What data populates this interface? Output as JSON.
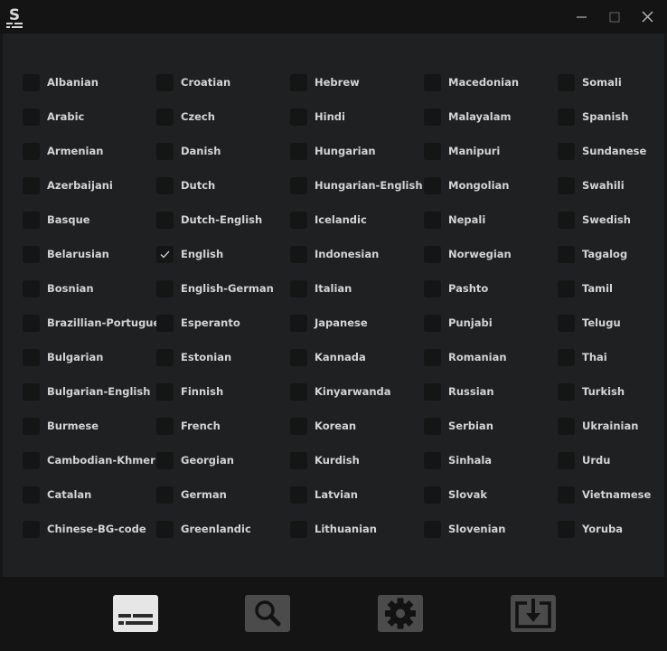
{
  "app": {
    "logo_letter": "S"
  },
  "window_controls": {
    "minimize_icon": "minimize-icon",
    "maximize_icon": "maximize-icon",
    "close_icon": "close-icon"
  },
  "languages": [
    {
      "label": "Albanian",
      "checked": false
    },
    {
      "label": "Arabic",
      "checked": false
    },
    {
      "label": "Armenian",
      "checked": false
    },
    {
      "label": "Azerbaijani",
      "checked": false
    },
    {
      "label": "Basque",
      "checked": false
    },
    {
      "label": "Belarusian",
      "checked": false
    },
    {
      "label": "Bosnian",
      "checked": false
    },
    {
      "label": "Brazillian-Portuguese",
      "checked": false
    },
    {
      "label": "Bulgarian",
      "checked": false
    },
    {
      "label": "Bulgarian-English",
      "checked": false
    },
    {
      "label": "Burmese",
      "checked": false
    },
    {
      "label": "Cambodian-Khmer",
      "checked": false
    },
    {
      "label": "Catalan",
      "checked": false
    },
    {
      "label": "Chinese-BG-code",
      "checked": false
    },
    {
      "label": "Croatian",
      "checked": false
    },
    {
      "label": "Czech",
      "checked": false
    },
    {
      "label": "Danish",
      "checked": false
    },
    {
      "label": "Dutch",
      "checked": false
    },
    {
      "label": "Dutch-English",
      "checked": false
    },
    {
      "label": "English",
      "checked": true
    },
    {
      "label": "English-German",
      "checked": false
    },
    {
      "label": "Esperanto",
      "checked": false
    },
    {
      "label": "Estonian",
      "checked": false
    },
    {
      "label": "Finnish",
      "checked": false
    },
    {
      "label": "French",
      "checked": false
    },
    {
      "label": "Georgian",
      "checked": false
    },
    {
      "label": "German",
      "checked": false
    },
    {
      "label": "Greenlandic",
      "checked": false
    },
    {
      "label": "Hebrew",
      "checked": false
    },
    {
      "label": "Hindi",
      "checked": false
    },
    {
      "label": "Hungarian",
      "checked": false
    },
    {
      "label": "Hungarian-English",
      "checked": false
    },
    {
      "label": "Icelandic",
      "checked": false
    },
    {
      "label": "Indonesian",
      "checked": false
    },
    {
      "label": "Italian",
      "checked": false
    },
    {
      "label": "Japanese",
      "checked": false
    },
    {
      "label": "Kannada",
      "checked": false
    },
    {
      "label": "Kinyarwanda",
      "checked": false
    },
    {
      "label": "Korean",
      "checked": false
    },
    {
      "label": "Kurdish",
      "checked": false
    },
    {
      "label": "Latvian",
      "checked": false
    },
    {
      "label": "Lithuanian",
      "checked": false
    },
    {
      "label": "Macedonian",
      "checked": false
    },
    {
      "label": "Malayalam",
      "checked": false
    },
    {
      "label": "Manipuri",
      "checked": false
    },
    {
      "label": "Mongolian",
      "checked": false
    },
    {
      "label": "Nepali",
      "checked": false
    },
    {
      "label": "Norwegian",
      "checked": false
    },
    {
      "label": "Pashto",
      "checked": false
    },
    {
      "label": "Punjabi",
      "checked": false
    },
    {
      "label": "Romanian",
      "checked": false
    },
    {
      "label": "Russian",
      "checked": false
    },
    {
      "label": "Serbian",
      "checked": false
    },
    {
      "label": "Sinhala",
      "checked": false
    },
    {
      "label": "Slovak",
      "checked": false
    },
    {
      "label": "Slovenian",
      "checked": false
    },
    {
      "label": "Somali",
      "checked": false
    },
    {
      "label": "Spanish",
      "checked": false
    },
    {
      "label": "Sundanese",
      "checked": false
    },
    {
      "label": "Swahili",
      "checked": false
    },
    {
      "label": "Swedish",
      "checked": false
    },
    {
      "label": "Tagalog",
      "checked": false
    },
    {
      "label": "Tamil",
      "checked": false
    },
    {
      "label": "Telugu",
      "checked": false
    },
    {
      "label": "Thai",
      "checked": false
    },
    {
      "label": "Turkish",
      "checked": false
    },
    {
      "label": "Ukrainian",
      "checked": false
    },
    {
      "label": "Urdu",
      "checked": false
    },
    {
      "label": "Vietnamese",
      "checked": false
    },
    {
      "label": "Yoruba",
      "checked": false
    }
  ],
  "bottom_nav": [
    {
      "icon": "subtitles-icon",
      "active": true
    },
    {
      "icon": "search-icon",
      "active": false
    },
    {
      "icon": "gear-icon",
      "active": false
    },
    {
      "icon": "download-icon",
      "active": false
    }
  ],
  "colors": {
    "background": "#161616",
    "panel": "#1e2021",
    "checkbox": "#141515",
    "text": "#d4d4d4",
    "nav_active": "#e6e6e6",
    "nav_inactive": "#4b4b4b"
  }
}
